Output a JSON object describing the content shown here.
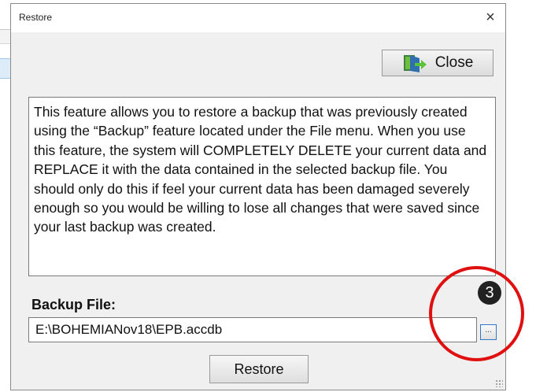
{
  "dialog": {
    "title": "Restore",
    "close_glyph": "×",
    "close_button_label": "Close",
    "close_button_icon": "exit-door-icon",
    "info_text": "This feature allows you to restore a backup that was previously created using the “Backup” feature located under the File menu. When you use this feature, the system will COMPLETELY DELETE your current data and REPLACE it with the data contained in the selected backup file. You should only do this if feel your current data has been damaged severely enough so you would be willing to lose all changes that were saved since your last backup was created.",
    "backup_file_label": "Backup File:",
    "backup_file_value": "E:\\BOHEMIANov18\\EPB.accdb",
    "browse_button_label": "...",
    "restore_button_label": "Restore"
  },
  "annotation": {
    "step_number": "3",
    "color": "#e01010"
  }
}
